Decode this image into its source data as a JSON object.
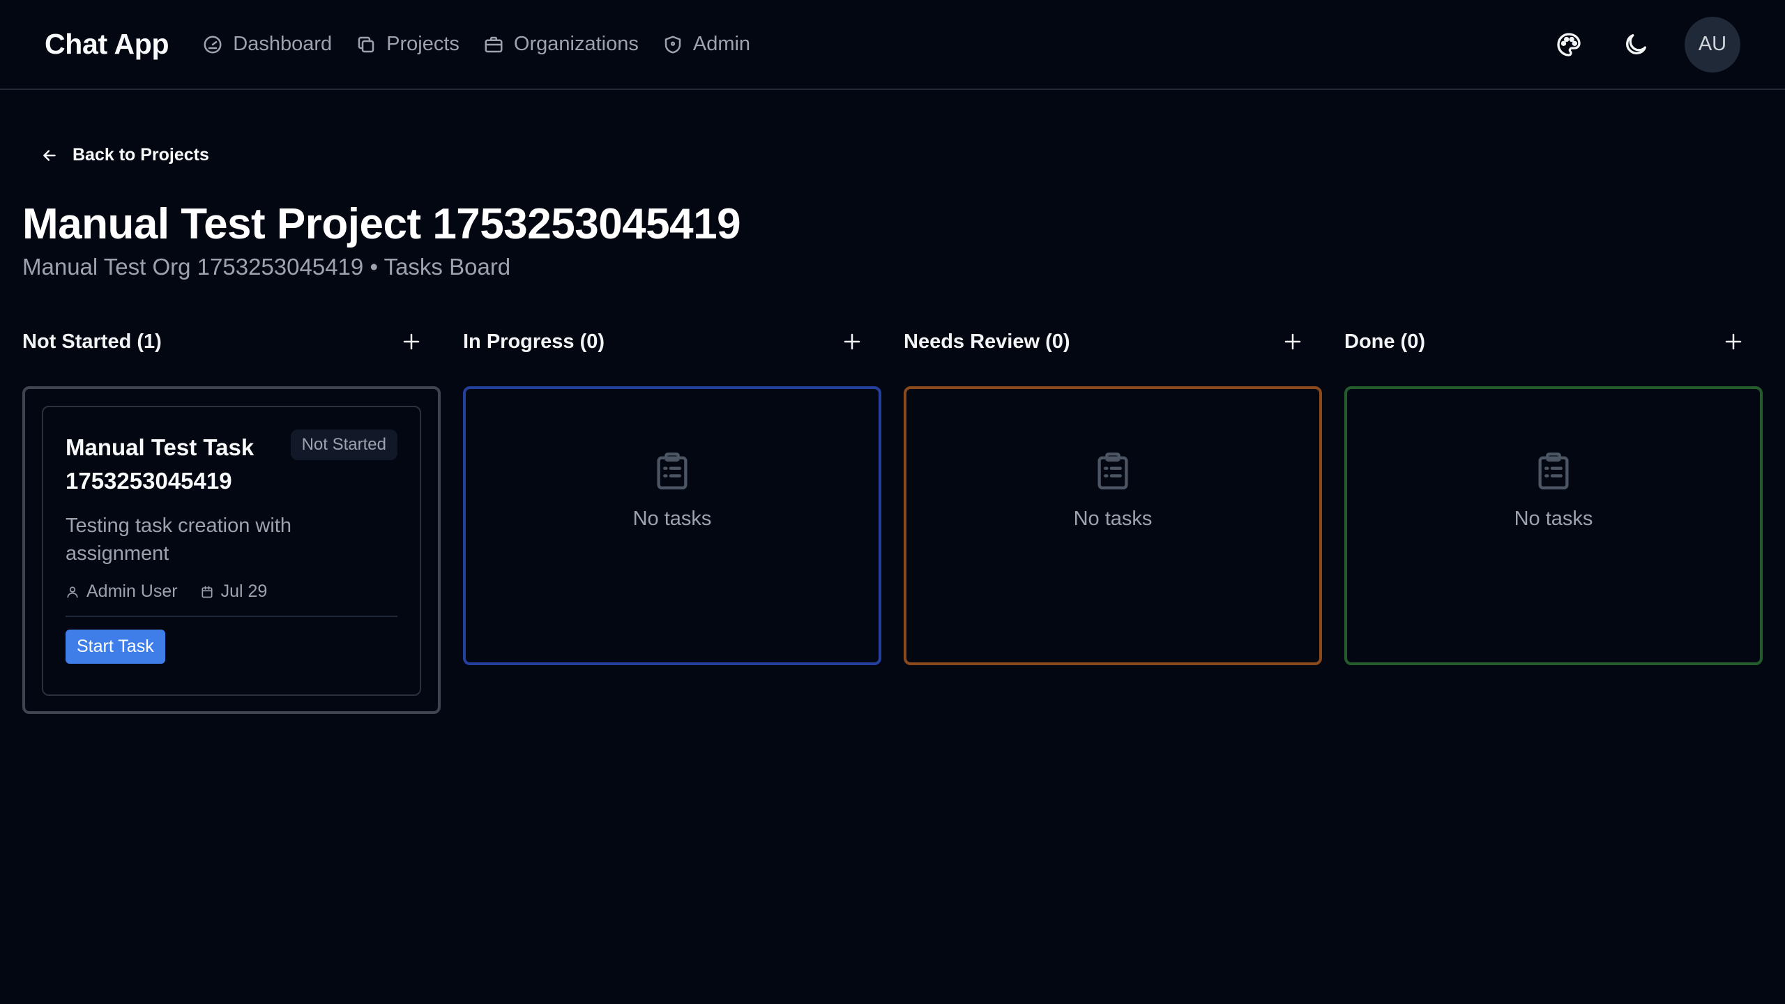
{
  "header": {
    "brand": "Chat App",
    "nav": [
      {
        "label": "Dashboard",
        "icon": "gauge-icon"
      },
      {
        "label": "Projects",
        "icon": "copy-icon"
      },
      {
        "label": "Organizations",
        "icon": "briefcase-icon"
      },
      {
        "label": "Admin",
        "icon": "shield-icon"
      }
    ],
    "avatar_initials": "AU"
  },
  "page": {
    "back_label": "Back to Projects",
    "title": "Manual Test Project 1753253045419",
    "org": "Manual Test Org 1753253045419",
    "separator": "•",
    "board_label": "Tasks Board"
  },
  "columns": [
    {
      "title": "Not Started (1)",
      "accent": "#3f4451"
    },
    {
      "title": "In Progress (0)",
      "accent": "#243f9c",
      "empty": "No tasks"
    },
    {
      "title": "Needs Review (0)",
      "accent": "#8a4a1c",
      "empty": "No tasks"
    },
    {
      "title": "Done (0)",
      "accent": "#245c2e",
      "empty": "No tasks"
    }
  ],
  "task": {
    "title": "Manual Test Task 1753253045419",
    "status": "Not Started",
    "description": "Testing task creation with assignment",
    "assignee": "Admin User",
    "due": "Jul 29",
    "action": "Start Task"
  },
  "colors": {
    "background": "#030712",
    "primary_button": "#3f7ee8",
    "muted_text": "#9ca3af"
  }
}
